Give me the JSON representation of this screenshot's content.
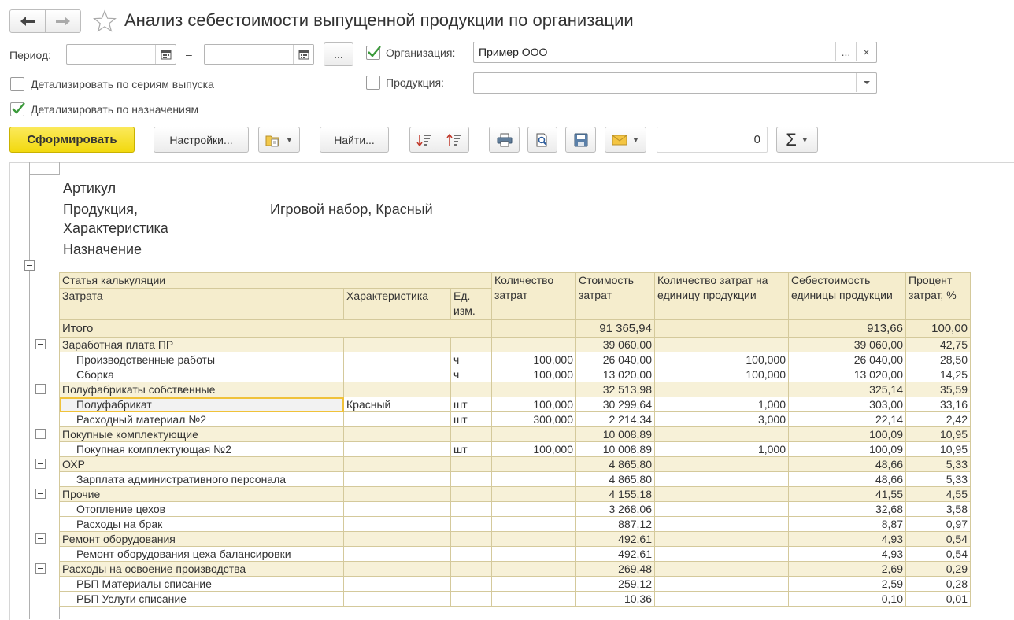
{
  "window": {
    "title": "Анализ себестоимости выпущенной продукции по организации"
  },
  "form": {
    "period_label": "Период:",
    "period_start": "",
    "period_end": "",
    "period_dash": "–",
    "period_select_label": "...",
    "org_label": "Организация:",
    "org_checked": true,
    "org_value": "Пример ООО",
    "org_select_label": "...",
    "org_clear_label": "×",
    "product_label": "Продукция:",
    "product_checked": false,
    "product_value": "",
    "detail_series_label": "Детализировать по сериям выпуска",
    "detail_series_checked": false,
    "detail_purpose_label": "Детализировать по назначениям",
    "detail_purpose_checked": true
  },
  "toolbar": {
    "generate_label": "Сформировать",
    "settings_label": "Настройки...",
    "find_label": "Найти...",
    "count_value": "0",
    "sum_label": "Σ"
  },
  "report": {
    "article_label": "Артикул",
    "product_label": "Продукция,",
    "characteristic_label": "Характеристика",
    "purpose_label": "Назначение",
    "product_value": "Игровой набор, Красный",
    "headers": {
      "cost_item": "Статья калькуляции",
      "expense": "Затрата",
      "characteristic": "Характеристика",
      "unit_1": "Ед.",
      "unit_2": "изм.",
      "qty_1": "Количество",
      "qty_2": "затрат",
      "cost_1": "Стоимость",
      "cost_2": "затрат",
      "per_unit_1": "Количество затрат на",
      "per_unit_2": "единицу продукции",
      "unit_cost_1": "Себестоимость",
      "unit_cost_2": "единицы продукции",
      "pct_1": "Процент",
      "pct_2": "затрат, %"
    },
    "total": {
      "label": "Итого",
      "cost": "91 365,94",
      "unit_cost": "913,66",
      "pct": "100,00"
    },
    "rows": [
      {
        "kind": "grp",
        "name": "Заработная плата ПР",
        "char": "",
        "unit": "",
        "qty": "",
        "cost": "39 060,00",
        "per_unit": "",
        "unit_cost": "39 060,00",
        "pct": "42,75"
      },
      {
        "kind": "item",
        "name": "Производственные работы",
        "char": "",
        "unit": "ч",
        "qty": "100,000",
        "cost": "26 040,00",
        "per_unit": "100,000",
        "unit_cost": "26 040,00",
        "pct": "28,50"
      },
      {
        "kind": "item",
        "name": "Сборка",
        "char": "",
        "unit": "ч",
        "qty": "100,000",
        "cost": "13 020,00",
        "per_unit": "100,000",
        "unit_cost": "13 020,00",
        "pct": "14,25"
      },
      {
        "kind": "grp",
        "name": "Полуфабрикаты собственные",
        "char": "",
        "unit": "",
        "qty": "",
        "cost": "32 513,98",
        "per_unit": "",
        "unit_cost": "325,14",
        "pct": "35,59"
      },
      {
        "kind": "item",
        "name": "Полуфабрикат",
        "char": "Красный",
        "unit": "шт",
        "qty": "100,000",
        "cost": "30 299,64",
        "per_unit": "1,000",
        "unit_cost": "303,00",
        "pct": "33,16",
        "selected": true
      },
      {
        "kind": "item",
        "name": "Расходный материал №2",
        "char": "",
        "unit": "шт",
        "qty": "300,000",
        "cost": "2 214,34",
        "per_unit": "3,000",
        "unit_cost": "22,14",
        "pct": "2,42"
      },
      {
        "kind": "grp",
        "name": "Покупные комплектующие",
        "char": "",
        "unit": "",
        "qty": "",
        "cost": "10 008,89",
        "per_unit": "",
        "unit_cost": "100,09",
        "pct": "10,95"
      },
      {
        "kind": "item",
        "name": "Покупная комплектующая №2",
        "char": "",
        "unit": "шт",
        "qty": "100,000",
        "cost": "10 008,89",
        "per_unit": "1,000",
        "unit_cost": "100,09",
        "pct": "10,95"
      },
      {
        "kind": "grp",
        "name": "ОХР",
        "char": "",
        "unit": "",
        "qty": "",
        "cost": "4 865,80",
        "per_unit": "",
        "unit_cost": "48,66",
        "pct": "5,33"
      },
      {
        "kind": "item",
        "name": "Зарплата административного персонала",
        "char": "",
        "unit": "",
        "qty": "",
        "cost": "4 865,80",
        "per_unit": "",
        "unit_cost": "48,66",
        "pct": "5,33"
      },
      {
        "kind": "grp",
        "name": "Прочие",
        "char": "",
        "unit": "",
        "qty": "",
        "cost": "4 155,18",
        "per_unit": "",
        "unit_cost": "41,55",
        "pct": "4,55"
      },
      {
        "kind": "item",
        "name": "Отопление цехов",
        "char": "",
        "unit": "",
        "qty": "",
        "cost": "3 268,06",
        "per_unit": "",
        "unit_cost": "32,68",
        "pct": "3,58"
      },
      {
        "kind": "item",
        "name": "Расходы на брак",
        "char": "",
        "unit": "",
        "qty": "",
        "cost": "887,12",
        "per_unit": "",
        "unit_cost": "8,87",
        "pct": "0,97"
      },
      {
        "kind": "grp",
        "name": "Ремонт оборудования",
        "char": "",
        "unit": "",
        "qty": "",
        "cost": "492,61",
        "per_unit": "",
        "unit_cost": "4,93",
        "pct": "0,54"
      },
      {
        "kind": "item",
        "name": "Ремонт оборудования цеха балансировки",
        "char": "",
        "unit": "",
        "qty": "",
        "cost": "492,61",
        "per_unit": "",
        "unit_cost": "4,93",
        "pct": "0,54"
      },
      {
        "kind": "grp",
        "name": "Расходы на освоение производства",
        "char": "",
        "unit": "",
        "qty": "",
        "cost": "269,48",
        "per_unit": "",
        "unit_cost": "2,69",
        "pct": "0,29"
      },
      {
        "kind": "item",
        "name": "РБП Материалы списание",
        "char": "",
        "unit": "",
        "qty": "",
        "cost": "259,12",
        "per_unit": "",
        "unit_cost": "2,59",
        "pct": "0,28"
      },
      {
        "kind": "item",
        "name": "РБП Услуги списание",
        "char": "",
        "unit": "",
        "qty": "",
        "cost": "10,36",
        "per_unit": "",
        "unit_cost": "0,10",
        "pct": "0,01"
      }
    ]
  }
}
